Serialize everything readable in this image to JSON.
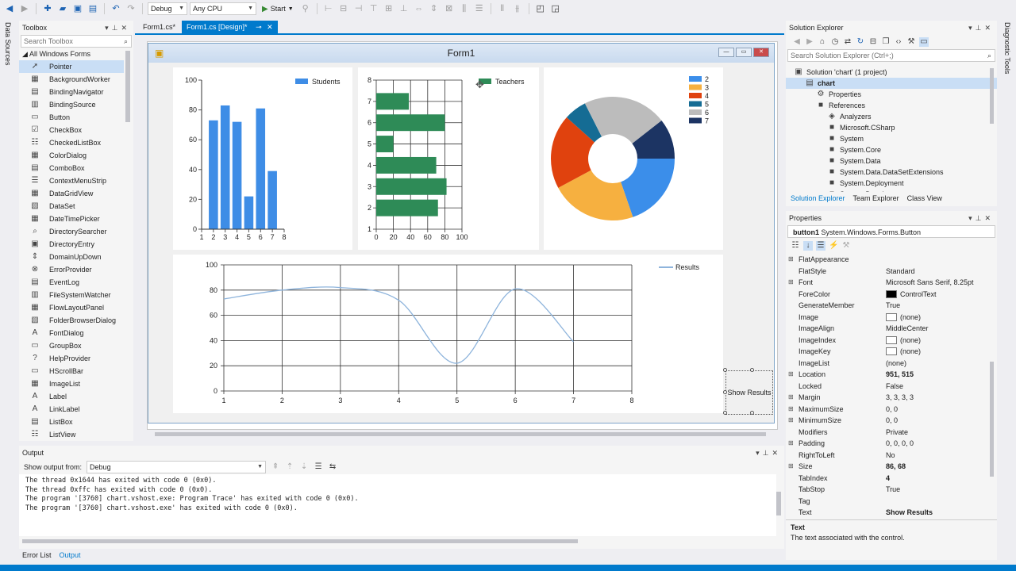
{
  "toolbar": {
    "config": "Debug",
    "platform": "Any CPU",
    "start_label": "Start"
  },
  "left_strip": {
    "label": "Data Sources"
  },
  "right_strip": {
    "label": "Diagnostic Tools"
  },
  "toolbox": {
    "title": "Toolbox",
    "search_placeholder": "Search Toolbox",
    "group": "All Windows Forms",
    "items": [
      {
        "label": "Pointer",
        "icon": "pointer-icon",
        "glyph": "➚"
      },
      {
        "label": "BackgroundWorker",
        "icon": "backgroundworker-icon",
        "glyph": "▦"
      },
      {
        "label": "BindingNavigator",
        "icon": "bindingnavigator-icon",
        "glyph": "▤"
      },
      {
        "label": "BindingSource",
        "icon": "bindingsource-icon",
        "glyph": "▥"
      },
      {
        "label": "Button",
        "icon": "button-icon",
        "glyph": "▭"
      },
      {
        "label": "CheckBox",
        "icon": "checkbox-icon",
        "glyph": "☑"
      },
      {
        "label": "CheckedListBox",
        "icon": "checkedlistbox-icon",
        "glyph": "☷"
      },
      {
        "label": "ColorDialog",
        "icon": "colordialog-icon",
        "glyph": "▦"
      },
      {
        "label": "ComboBox",
        "icon": "combobox-icon",
        "glyph": "▤"
      },
      {
        "label": "ContextMenuStrip",
        "icon": "contextmenustrip-icon",
        "glyph": "☰"
      },
      {
        "label": "DataGridView",
        "icon": "datagridview-icon",
        "glyph": "▦"
      },
      {
        "label": "DataSet",
        "icon": "dataset-icon",
        "glyph": "▧"
      },
      {
        "label": "DateTimePicker",
        "icon": "datetimepicker-icon",
        "glyph": "▦"
      },
      {
        "label": "DirectorySearcher",
        "icon": "directorysearcher-icon",
        "glyph": "⌕"
      },
      {
        "label": "DirectoryEntry",
        "icon": "directoryentry-icon",
        "glyph": "▣"
      },
      {
        "label": "DomainUpDown",
        "icon": "domainupdown-icon",
        "glyph": "⇕"
      },
      {
        "label": "ErrorProvider",
        "icon": "errorprovider-icon",
        "glyph": "⊗"
      },
      {
        "label": "EventLog",
        "icon": "eventlog-icon",
        "glyph": "▤"
      },
      {
        "label": "FileSystemWatcher",
        "icon": "filesystemwatcher-icon",
        "glyph": "▥"
      },
      {
        "label": "FlowLayoutPanel",
        "icon": "flowlayoutpanel-icon",
        "glyph": "▦"
      },
      {
        "label": "FolderBrowserDialog",
        "icon": "folderbrowserdialog-icon",
        "glyph": "▧"
      },
      {
        "label": "FontDialog",
        "icon": "fontdialog-icon",
        "glyph": "A"
      },
      {
        "label": "GroupBox",
        "icon": "groupbox-icon",
        "glyph": "▭"
      },
      {
        "label": "HelpProvider",
        "icon": "helpprovider-icon",
        "glyph": "?"
      },
      {
        "label": "HScrollBar",
        "icon": "hscrollbar-icon",
        "glyph": "▭"
      },
      {
        "label": "ImageList",
        "icon": "imagelist-icon",
        "glyph": "▦"
      },
      {
        "label": "Label",
        "icon": "label-icon",
        "glyph": "A"
      },
      {
        "label": "LinkLabel",
        "icon": "linklabel-icon",
        "glyph": "A"
      },
      {
        "label": "ListBox",
        "icon": "listbox-icon",
        "glyph": "▤"
      },
      {
        "label": "ListView",
        "icon": "listview-icon",
        "glyph": "☷"
      }
    ]
  },
  "editor": {
    "tabs": [
      {
        "label": "Form1.cs*"
      },
      {
        "label": "Form1.cs [Design]*"
      }
    ],
    "form_title": "Form1"
  },
  "show_results_label": "Show Results",
  "chart_data": [
    {
      "type": "bar",
      "categories": [
        "1",
        "2",
        "3",
        "4",
        "5",
        "6",
        "7",
        "8"
      ],
      "series": [
        {
          "name": "Students",
          "x": [
            2,
            3,
            4,
            5,
            6,
            7
          ],
          "values": [
            73,
            83,
            72,
            22,
            81,
            39
          ]
        }
      ],
      "ylim": [
        0,
        100
      ],
      "yticks": [
        "0",
        "20",
        "40",
        "60",
        "80",
        "100"
      ],
      "color": "#3e8de6"
    },
    {
      "type": "bar",
      "orientation": "horizontal",
      "categories": [
        "2",
        "3",
        "4",
        "5",
        "6",
        "7"
      ],
      "series": [
        {
          "name": "Teachers",
          "values": [
            72,
            82,
            70,
            20,
            80,
            38
          ]
        }
      ],
      "xlim": [
        0,
        100
      ],
      "xticks": [
        "0",
        "20",
        "40",
        "60",
        "80",
        "100"
      ],
      "yticks": [
        "1",
        "2",
        "3",
        "4",
        "5",
        "6",
        "7",
        "8"
      ],
      "color": "#2e8b57"
    },
    {
      "type": "pie",
      "style": "doughnut",
      "labels": [
        "2",
        "3",
        "4",
        "5",
        "6",
        "7"
      ],
      "values": [
        73,
        83,
        72,
        22,
        81,
        39
      ],
      "colors": [
        "#3b8eea",
        "#f6b040",
        "#e0420e",
        "#156c94",
        "#bcbcbc",
        "#1c3463"
      ]
    },
    {
      "type": "line",
      "series": [
        {
          "name": "Results",
          "x": [
            1,
            2,
            3,
            4,
            5,
            6,
            7
          ],
          "values": [
            73,
            80,
            82,
            72,
            22,
            81,
            39
          ]
        }
      ],
      "xlim": [
        1,
        8
      ],
      "ylim": [
        0,
        100
      ],
      "xticks": [
        "1",
        "2",
        "3",
        "4",
        "5",
        "6",
        "7",
        "8"
      ],
      "yticks": [
        "0",
        "20",
        "40",
        "60",
        "80",
        "100"
      ],
      "color": "#8eb4dc"
    }
  ],
  "solution": {
    "title": "Solution Explorer",
    "search_placeholder": "Search Solution Explorer (Ctrl+;)",
    "items": [
      {
        "label": "Solution 'chart' (1 project)",
        "indent": 0,
        "glyph": "▣"
      },
      {
        "label": "chart",
        "indent": 1,
        "glyph": "▤"
      },
      {
        "label": "Properties",
        "indent": 2,
        "glyph": "⚙"
      },
      {
        "label": "References",
        "indent": 2,
        "glyph": "■"
      },
      {
        "label": "Analyzers",
        "indent": 3,
        "glyph": "◈"
      },
      {
        "label": "Microsoft.CSharp",
        "indent": 3,
        "glyph": "■"
      },
      {
        "label": "System",
        "indent": 3,
        "glyph": "■"
      },
      {
        "label": "System.Core",
        "indent": 3,
        "glyph": "■"
      },
      {
        "label": "System.Data",
        "indent": 3,
        "glyph": "■"
      },
      {
        "label": "System.Data.DataSetExtensions",
        "indent": 3,
        "glyph": "■"
      },
      {
        "label": "System.Deployment",
        "indent": 3,
        "glyph": "■"
      },
      {
        "label": "System.Drawing",
        "indent": 3,
        "glyph": "■"
      }
    ],
    "bottom_tabs": [
      "Solution Explorer",
      "Team Explorer",
      "Class View"
    ]
  },
  "properties": {
    "title": "Properties",
    "object_name": "button1",
    "object_type": "System.Windows.Forms.Button",
    "rows": [
      {
        "name": "FlatAppearance",
        "value": "",
        "expand": true
      },
      {
        "name": "FlatStyle",
        "value": "Standard"
      },
      {
        "name": "Font",
        "value": "Microsoft Sans Serif, 8.25pt",
        "expand": true
      },
      {
        "name": "ForeColor",
        "value": "ControlText",
        "swatch": "black"
      },
      {
        "name": "GenerateMember",
        "value": "True"
      },
      {
        "name": "Image",
        "value": "(none)",
        "swatch": "white"
      },
      {
        "name": "ImageAlign",
        "value": "MiddleCenter"
      },
      {
        "name": "ImageIndex",
        "value": "(none)",
        "swatch": "white"
      },
      {
        "name": "ImageKey",
        "value": "(none)",
        "swatch": "white"
      },
      {
        "name": "ImageList",
        "value": "(none)"
      },
      {
        "name": "Location",
        "value": "951, 515",
        "expand": true,
        "bold": true
      },
      {
        "name": "Locked",
        "value": "False"
      },
      {
        "name": "Margin",
        "value": "3, 3, 3, 3",
        "expand": true
      },
      {
        "name": "MaximumSize",
        "value": "0, 0",
        "expand": true
      },
      {
        "name": "MinimumSize",
        "value": "0, 0",
        "expand": true
      },
      {
        "name": "Modifiers",
        "value": "Private"
      },
      {
        "name": "Padding",
        "value": "0, 0, 0, 0",
        "expand": true
      },
      {
        "name": "RightToLeft",
        "value": "No"
      },
      {
        "name": "Size",
        "value": "86, 68",
        "expand": true,
        "bold": true
      },
      {
        "name": "TabIndex",
        "value": "4",
        "bold": true
      },
      {
        "name": "TabStop",
        "value": "True"
      },
      {
        "name": "Tag",
        "value": ""
      },
      {
        "name": "Text",
        "value": "Show Results",
        "bold": true
      }
    ],
    "desc_title": "Text",
    "desc_text": "The text associated with the control."
  },
  "output": {
    "title": "Output",
    "show_from_label": "Show output from:",
    "source": "Debug",
    "lines": [
      "The thread 0x1644 has exited with code 0 (0x0).",
      "The thread 0xffc has exited with code 0 (0x0).",
      "The program '[3760] chart.vshost.exe: Program Trace' has exited with code 0 (0x0).",
      "The program '[3760] chart.vshost.exe' has exited with code 0 (0x0)."
    ],
    "tabs": [
      "Error List",
      "Output"
    ]
  }
}
